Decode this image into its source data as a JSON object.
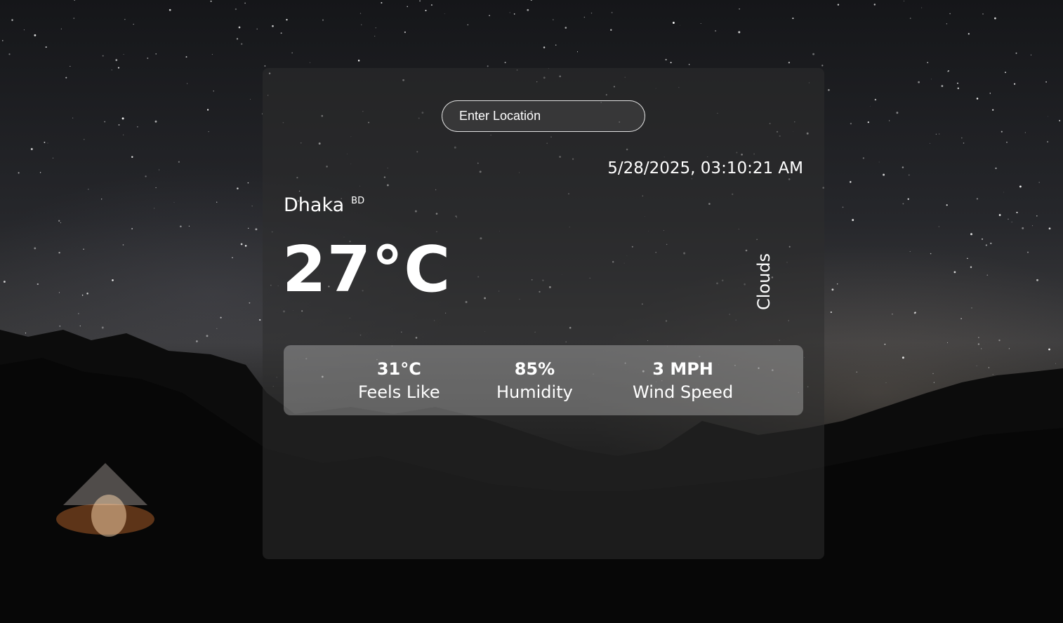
{
  "search": {
    "placeholder": "Enter Location",
    "value": ""
  },
  "weather": {
    "datetime": "5/28/2025, 03:10:21 AM",
    "city": "Dhaka",
    "country": "BD",
    "temperature": "27°C",
    "condition": "Clouds"
  },
  "stats": [
    {
      "value": "31°C",
      "label": "Feels Like"
    },
    {
      "value": "85%",
      "label": "Humidity"
    },
    {
      "value": "3 MPH",
      "label": "Wind Speed"
    }
  ],
  "colors": {
    "text": "#ffffff",
    "card_bg": "rgba(45,45,45,0.55)",
    "stats_bg": "rgba(255,255,255,0.28)"
  }
}
